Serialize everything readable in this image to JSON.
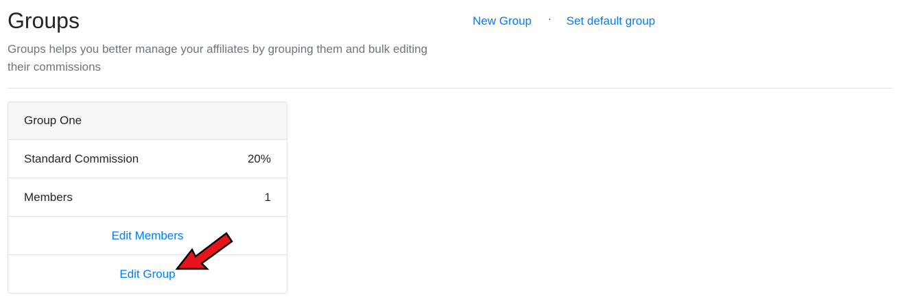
{
  "header": {
    "title": "Groups",
    "subtitle": "Groups helps you better manage your affiliates by grouping them and bulk editing their commissions",
    "actions": {
      "new_group": "New Group",
      "separator": "·",
      "set_default": "Set default group"
    }
  },
  "group_card": {
    "name": "Group One",
    "rows": [
      {
        "label": "Standard Commission",
        "value": "20%"
      },
      {
        "label": "Members",
        "value": "1"
      }
    ],
    "edit_members": "Edit Members",
    "edit_group": "Edit Group"
  },
  "colors": {
    "link": "#007bff",
    "arrow": "#e8141c",
    "muted_text": "#6c757d",
    "border": "#dee2e6",
    "header_bg": "#f7f7f7"
  },
  "annotation": {
    "icon": "red-arrow-icon"
  }
}
